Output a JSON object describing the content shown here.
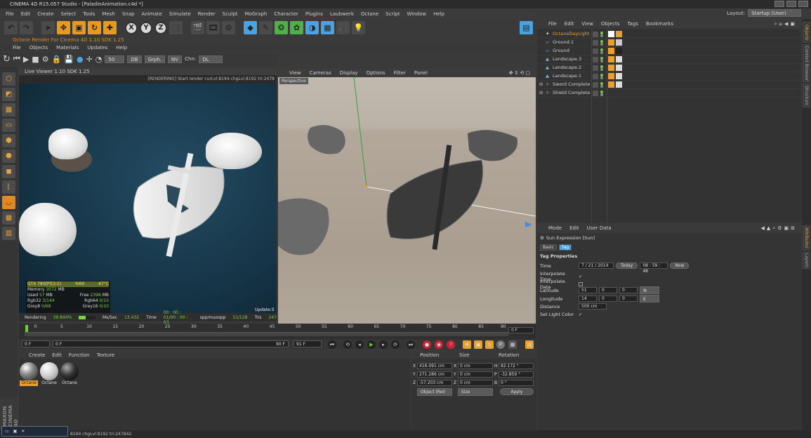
{
  "window": {
    "title": "CINEMA 4D R15.057 Studio - [PaladinAnimation.c4d *]"
  },
  "menubar": [
    "File",
    "Edit",
    "Create",
    "Select",
    "Tools",
    "Mesh",
    "Snap",
    "Animate",
    "Simulate",
    "Render",
    "Sculpt",
    "MoGraph",
    "Character",
    "Plugins",
    "Laubwerk",
    "Octane",
    "Script",
    "Window",
    "Help"
  ],
  "layout": {
    "label": "Layout:",
    "value": "Startup (User)"
  },
  "toolbar": {
    "axis_x": "X",
    "axis_y": "Y",
    "axis_z": "Z"
  },
  "octane": {
    "title": "Octane Render For Cinema 4D 1.10   SDK 1.25",
    "menu": [
      "File",
      "Objects",
      "Materials",
      "Updates",
      "Help"
    ],
    "value": "50",
    "db": "DB",
    "graph": "Grph.",
    "nv": "NV",
    "chn_label": "Chn:",
    "chn_value": "DL"
  },
  "live_viewer": {
    "title": "Live Viewer 1.10   SDK 1.25",
    "status": "[RENDERING] Start render curLvl:8194 chgLvl:8192 tri:2478",
    "stats": {
      "gpu": "GTX 780[P](3.5)",
      "gpu_pct": "%60",
      "temp": "47°C",
      "memory_label": "Memory",
      "memory": "3072",
      "mb": "MB",
      "used_label": "Used",
      "used": "57",
      "free_label": "Free",
      "free": "2398",
      "rgb32_label": "Rgb32",
      "rgb32": "3/144",
      "rgb64_label": "Rgb64",
      "rgb64": "0/10",
      "grey8_label": "Grey8",
      "grey8": "0/68",
      "grey16_label": "Grey16",
      "grey16": "0/10"
    },
    "update": "Update:S",
    "bottom": {
      "rendering_label": "Rendering",
      "rendering_pct": "39.844%",
      "rendering_progress": 0.398,
      "ms_label": "Ms/Sec",
      "ms": "13.432",
      "time_label": "Time",
      "time": "00 : 00 : 01/00 : 00 : 03",
      "spp_label": "spp/maxspp",
      "spp": "51/128",
      "tris_label": "Tris",
      "tris": "247"
    }
  },
  "viewport": {
    "menu": [
      "View",
      "Cameras",
      "Display",
      "Options",
      "Filter",
      "Panel"
    ],
    "camera": "Perspective"
  },
  "timeline": {
    "ticks": [
      "0",
      "5",
      "10",
      "15",
      "20",
      "25",
      "30",
      "35",
      "40",
      "45",
      "50",
      "55",
      "60",
      "65",
      "70",
      "75",
      "80",
      "85",
      "90"
    ],
    "end_frame": "0 F"
  },
  "transport": {
    "start": "0 F",
    "range_start": "0 F",
    "range_end": "90 F",
    "end": "91 F"
  },
  "materials": {
    "menu": [
      "Create",
      "Edit",
      "Function",
      "Texture"
    ],
    "items": [
      "Octane",
      "Octane",
      "Octane"
    ]
  },
  "coordinates": {
    "headers": [
      "Position",
      "Size",
      "Rotation"
    ],
    "rows": [
      {
        "axis": "X",
        "pos": "416.091 cm",
        "saxis": "X",
        "size": "0 cm",
        "raxis": "H",
        "rot": "82.172 °"
      },
      {
        "axis": "Y",
        "pos": "271.286 cm",
        "saxis": "Y",
        "size": "0 cm",
        "raxis": "P",
        "rot": "-32.859 °"
      },
      {
        "axis": "Z",
        "pos": "-57.203 cm",
        "saxis": "Z",
        "size": "0 cm",
        "raxis": "B",
        "rot": "0 °"
      }
    ],
    "mode": "Object (Rel)",
    "size_mode": "Size",
    "apply": "Apply"
  },
  "objects": {
    "menu": [
      "File",
      "Edit",
      "View",
      "Objects",
      "Tags",
      "Bookmarks"
    ],
    "items": [
      {
        "name": "OctaneDayLight",
        "color": "#e8a030"
      },
      {
        "name": "Ground.1",
        "color": "#aee0ff"
      },
      {
        "name": "Ground",
        "color": "#aee0ff"
      },
      {
        "name": "Landscape.3",
        "color": "#aee0ff"
      },
      {
        "name": "Landscape.2",
        "color": "#aee0ff"
      },
      {
        "name": "Landscape.1",
        "color": "#aee0ff"
      },
      {
        "name": "Sword Complete",
        "color": "#cfcfcf"
      },
      {
        "name": "Shield Complete",
        "color": "#cfcfcf"
      }
    ]
  },
  "attributes": {
    "menu": [
      "Mode",
      "Edit",
      "User Data"
    ],
    "object": "Sun Expression [Sun]",
    "tabs": [
      "Basic",
      "Tag"
    ],
    "section": "Tag Properties",
    "time_label": "Time",
    "date": "7 / 21 / 2014",
    "today": "Today",
    "clock": "08 : 59 : 48",
    "now": "Now",
    "interp_time": "Interpolate Time",
    "interp_date": "Interpolate Date",
    "lat_label": "Latitude",
    "lat": [
      "51",
      "0",
      "0"
    ],
    "lat_dir": "N",
    "lon_label": "Longitude",
    "lon": [
      "14",
      "0",
      "0"
    ],
    "lon_dir": "E",
    "dist_label": "Distance",
    "dist": "500 cm",
    "light_label": "Set Light Color",
    "check": "✓"
  },
  "sidetabs": [
    "Objects",
    "Content Browser",
    "Structure",
    "Attributes",
    "Layers"
  ],
  "statusbar": "8194 chgLvl:8192 tri:247842",
  "brand": "MAXON CINEMA 4D",
  "colors": {
    "accent": "#e8a030",
    "green": "#6fcf3a",
    "selection": "#4aa3df"
  }
}
